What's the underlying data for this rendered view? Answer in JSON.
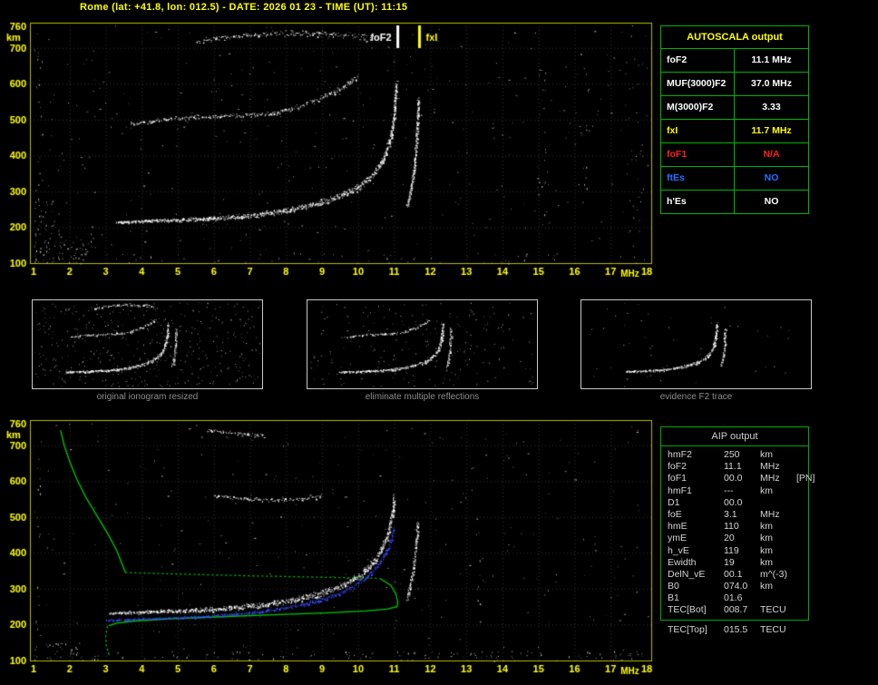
{
  "window": {
    "title": "Rome (lat: +41.8, lon: 012.5) - DATE: 2026 01 23 - TIME (UT): 11:15"
  },
  "colors": {
    "axis": "#ffff00",
    "plot_border": "#b9b900",
    "grid": "#343434",
    "table_green": "#00b400",
    "aip_text": "#d4d4d4",
    "caption_gray": "#8c8c8c",
    "profile_green": "#00c800",
    "restored_blue": "#3a4cff",
    "trace_white": "#ffffff",
    "error_red": "#ff2020",
    "info_blue": "#2970ff"
  },
  "autoscala_table": {
    "title": "AUTOSCALA output",
    "rows": [
      {
        "label": "foF2",
        "value": "11.1 MHz",
        "color": "#ffffff"
      },
      {
        "label": "MUF(3000)F2",
        "value": "37.0 MHz",
        "color": "#ffffff"
      },
      {
        "label": "M(3000)F2",
        "value": "3.33",
        "color": "#ffffff"
      },
      {
        "label": "fxI",
        "value": "11.7 MHz",
        "color": "#ffff00"
      },
      {
        "label": "foF1",
        "value": "N/A",
        "color": "#ff2020"
      },
      {
        "label": "ftEs",
        "value": "NO",
        "color": "#2970ff"
      },
      {
        "label": "h'Es",
        "value": "NO",
        "color": "#ffffff"
      }
    ]
  },
  "aip_table": {
    "title": "AIP output",
    "rows": [
      {
        "label": "hmF2",
        "value": "250",
        "unit": "km",
        "note": ""
      },
      {
        "label": "foF2",
        "value": "11.1",
        "unit": "MHz",
        "note": ""
      },
      {
        "label": "foF1",
        "value": "00.0",
        "unit": "MHz",
        "note": "[PN]"
      },
      {
        "label": "hmF1",
        "value": "---",
        "unit": "km",
        "note": ""
      },
      {
        "label": "D1",
        "value": "00.0",
        "unit": "",
        "note": ""
      },
      {
        "label": "foE",
        "value": "3.1",
        "unit": "MHz",
        "note": ""
      },
      {
        "label": "hmE",
        "value": "110",
        "unit": "km",
        "note": ""
      },
      {
        "label": "ymE",
        "value": "20",
        "unit": "km",
        "note": ""
      },
      {
        "label": "h_vE",
        "value": "119",
        "unit": "km",
        "note": ""
      },
      {
        "label": "Ewidth",
        "value": "19",
        "unit": "km",
        "note": ""
      },
      {
        "label": "DelN_vE",
        "value": "00.1",
        "unit": "m^(-3)",
        "note": ""
      },
      {
        "label": "B0",
        "value": "074.0",
        "unit": "km",
        "note": ""
      },
      {
        "label": "B1",
        "value": "01.6",
        "unit": "",
        "note": ""
      },
      {
        "label": "TEC[Bot]",
        "value": "008.7",
        "unit": "TECU",
        "note": ""
      }
    ],
    "tec_top": {
      "label": "TEC[Top]",
      "value": "015.5",
      "unit": "TECU"
    }
  },
  "thumbnails": [
    {
      "caption": "original ionogram resized",
      "trace_indices": [
        0,
        1,
        2,
        3
      ],
      "noise": 430,
      "seed": 31,
      "f_min": 1
    },
    {
      "caption": "eliminate multiple reflections",
      "trace_indices": [
        0,
        1,
        2
      ],
      "noise": 210,
      "seed": 32,
      "f_min": 1
    },
    {
      "caption": "evidence F2 trace",
      "trace_indices": [
        0,
        1
      ],
      "noise": 48,
      "seed": 33,
      "f_min": 4.2
    }
  ],
  "chart_data": [
    {
      "id": "top-ionogram",
      "type": "scatter",
      "title": "recorded ionogram",
      "xlabel": "MHz",
      "ylabel": "km",
      "xlim": [
        1,
        18
      ],
      "ylim": [
        100,
        760
      ],
      "xticks": [
        1,
        2,
        3,
        4,
        5,
        6,
        7,
        8,
        9,
        10,
        11,
        12,
        13,
        14,
        15,
        16,
        17,
        18
      ],
      "yticks": [
        760,
        700,
        600,
        500,
        400,
        300,
        200,
        100
      ],
      "grid": true,
      "markers": [
        {
          "label": "foF2",
          "freq": 11.1,
          "color": "#ffffff",
          "side": "left"
        },
        {
          "label": "fxI",
          "freq": 11.7,
          "color": "#ffff00",
          "side": "right"
        }
      ],
      "traces": [
        {
          "name": "F2-trace-first-hop",
          "points": [
            [
              3.3,
              215
            ],
            [
              4.2,
              219
            ],
            [
              5.2,
              222
            ],
            [
              6.2,
              227
            ],
            [
              7.2,
              235
            ],
            [
              8.0,
              248
            ],
            [
              8.8,
              265
            ],
            [
              9.5,
              288
            ],
            [
              10.0,
              312
            ],
            [
              10.4,
              345
            ],
            [
              10.7,
              390
            ],
            [
              10.9,
              450
            ],
            [
              11.0,
              520
            ],
            [
              11.05,
              600
            ]
          ],
          "density": 2.4,
          "jitter": [
            1.6,
            6
          ]
        },
        {
          "name": "F2-trace-x-mode",
          "points": [
            [
              11.35,
              260
            ],
            [
              11.45,
              300
            ],
            [
              11.55,
              360
            ],
            [
              11.6,
              430
            ],
            [
              11.64,
              500
            ],
            [
              11.66,
              560
            ]
          ],
          "density": 1.8,
          "jitter": [
            1.4,
            4
          ]
        },
        {
          "name": "second-hop-trace",
          "points": [
            [
              3.7,
              490
            ],
            [
              4.5,
              500
            ],
            [
              5.5,
              508
            ],
            [
              6.6,
              512
            ],
            [
              7.5,
              516
            ],
            [
              8.3,
              535
            ],
            [
              9.0,
              560
            ],
            [
              9.6,
              592
            ],
            [
              10.0,
              625
            ]
          ],
          "density": 1.1,
          "jitter": [
            2,
            4
          ]
        },
        {
          "name": "third-hop-trace",
          "points": [
            [
              5.5,
              716
            ],
            [
              6.2,
              728
            ],
            [
              7.0,
              737
            ],
            [
              8.0,
              742
            ],
            [
              9.0,
              740
            ],
            [
              9.8,
              734
            ],
            [
              10.4,
              726
            ]
          ],
          "density": 0.9,
          "jitter": [
            2.5,
            5
          ]
        }
      ],
      "noise": {
        "seed": 7,
        "count": 360,
        "clusters": [
          {
            "f": [
              1.0,
              2.6
            ],
            "km": [
              100,
              168
            ],
            "count": 70
          },
          {
            "f": [
              1.0,
              1.7
            ],
            "km": [
              168,
              280
            ],
            "count": 22
          },
          {
            "f": [
              1.0,
              1.25
            ],
            "km": [
              100,
              740
            ],
            "count": 30
          },
          {
            "f": [
              2.6,
              18.0
            ],
            "km": [
              100,
              130
            ],
            "count": 55
          },
          {
            "f": [
              15.0,
              15.3
            ],
            "km": [
              200,
              640
            ],
            "count": 18
          },
          {
            "f": [
              16.1,
              16.4
            ],
            "km": [
              250,
              600
            ],
            "count": 12
          },
          {
            "f": [
              17.4,
              18.0
            ],
            "km": [
              120,
              740
            ],
            "count": 26
          }
        ]
      }
    },
    {
      "id": "bottom-ionogram",
      "type": "scatter",
      "title": "cleaned ionogram with restored trace and electron density profile",
      "xlabel": "MHz",
      "ylabel": "km",
      "xlim": [
        1,
        18
      ],
      "ylim": [
        100,
        760
      ],
      "xticks": [
        1,
        2,
        3,
        4,
        5,
        6,
        7,
        8,
        9,
        10,
        11,
        12,
        13,
        14,
        15,
        16,
        17,
        18
      ],
      "yticks": [
        760,
        700,
        600,
        500,
        400,
        300,
        200,
        100
      ],
      "grid": true,
      "traces": [
        {
          "name": "F2-trace-first-hop",
          "points": [
            [
              3.1,
              232
            ],
            [
              4.0,
              236
            ],
            [
              5.0,
              239
            ],
            [
              6.0,
              244
            ],
            [
              7.0,
              252
            ],
            [
              8.0,
              266
            ],
            [
              8.8,
              283
            ],
            [
              9.5,
              307
            ],
            [
              10.1,
              340
            ],
            [
              10.5,
              385
            ],
            [
              10.8,
              445
            ],
            [
              10.95,
              510
            ],
            [
              11.0,
              560
            ]
          ],
          "density": 2.2,
          "jitter": [
            1.6,
            6
          ]
        },
        {
          "name": "F2-trace-x-mode",
          "points": [
            [
              11.35,
              270
            ],
            [
              11.5,
              340
            ],
            [
              11.6,
              420
            ],
            [
              11.65,
              490
            ]
          ],
          "density": 1.5,
          "jitter": [
            1.4,
            4
          ]
        },
        {
          "name": "second-hop-remnant",
          "points": [
            [
              6.0,
              560
            ],
            [
              6.8,
              552
            ],
            [
              7.7,
              548
            ],
            [
              8.5,
              552
            ],
            [
              9.0,
              560
            ]
          ],
          "density": 0.8,
          "jitter": [
            2,
            3
          ]
        },
        {
          "name": "third-hop-remnant",
          "points": [
            [
              5.8,
              742
            ],
            [
              6.6,
              734
            ],
            [
              7.4,
              728
            ]
          ],
          "density": 0.8,
          "jitter": [
            2,
            3
          ]
        }
      ],
      "restored_trace": {
        "name": "autoscala-restored-trace",
        "color": "#3a4cff",
        "points": [
          [
            3.0,
            212
          ],
          [
            3.6,
            215
          ],
          [
            4.4,
            218
          ],
          [
            5.2,
            221
          ],
          [
            6.0,
            225
          ],
          [
            6.8,
            231
          ],
          [
            7.6,
            241
          ],
          [
            8.4,
            255
          ],
          [
            9.1,
            274
          ],
          [
            9.7,
            298
          ],
          [
            10.2,
            330
          ],
          [
            10.6,
            372
          ],
          [
            10.85,
            420
          ],
          [
            11.0,
            470
          ]
        ],
        "density": 1.6,
        "jitter": [
          1.2,
          3
        ]
      },
      "profile": {
        "name": "electron-density-profile",
        "color": "#00c800",
        "segments": [
          {
            "style": "solid",
            "points": [
              [
                1.75,
                742
              ],
              [
                1.85,
                700
              ],
              [
                2.0,
                655
              ],
              [
                2.2,
                605
              ],
              [
                2.45,
                555
              ],
              [
                2.75,
                505
              ],
              [
                3.05,
                455
              ],
              [
                3.3,
                408
              ],
              [
                3.45,
                370
              ],
              [
                3.55,
                345
              ]
            ]
          },
          {
            "style": "dotted",
            "points": [
              [
                3.55,
                345
              ],
              [
                5.0,
                341
              ],
              [
                7.0,
                336
              ],
              [
                9.0,
                332
              ],
              [
                10.6,
                329
              ]
            ]
          },
          {
            "style": "solid",
            "points": [
              [
                10.6,
                329
              ],
              [
                10.9,
                310
              ],
              [
                11.05,
                285
              ],
              [
                11.1,
                262
              ],
              [
                11.08,
                250
              ],
              [
                10.8,
                243
              ],
              [
                10.2,
                238
              ],
              [
                9.2,
                233
              ],
              [
                7.8,
                228
              ],
              [
                6.2,
                222
              ],
              [
                4.8,
                216
              ],
              [
                3.8,
                210
              ],
              [
                3.3,
                204
              ],
              [
                3.08,
                197
              ]
            ]
          },
          {
            "style": "dotted",
            "points": [
              [
                3.05,
                195
              ],
              [
                3.0,
                168
              ],
              [
                3.02,
                140
              ],
              [
                3.1,
                115
              ]
            ]
          }
        ]
      },
      "noise": {
        "seed": 13,
        "count": 280,
        "clusters": [
          {
            "f": [
              1.0,
              2.4
            ],
            "km": [
              100,
              150
            ],
            "count": 36
          },
          {
            "f": [
              1.0,
              1.2
            ],
            "km": [
              100,
              700
            ],
            "count": 18
          },
          {
            "f": [
              9.0,
              18.0
            ],
            "km": [
              100,
              128
            ],
            "count": 85
          },
          {
            "f": [
              2.5,
              9.0
            ],
            "km": [
              100,
              126
            ],
            "count": 40
          },
          {
            "f": [
              13.2,
              13.45
            ],
            "km": [
              150,
              520
            ],
            "count": 12
          }
        ]
      }
    }
  ]
}
